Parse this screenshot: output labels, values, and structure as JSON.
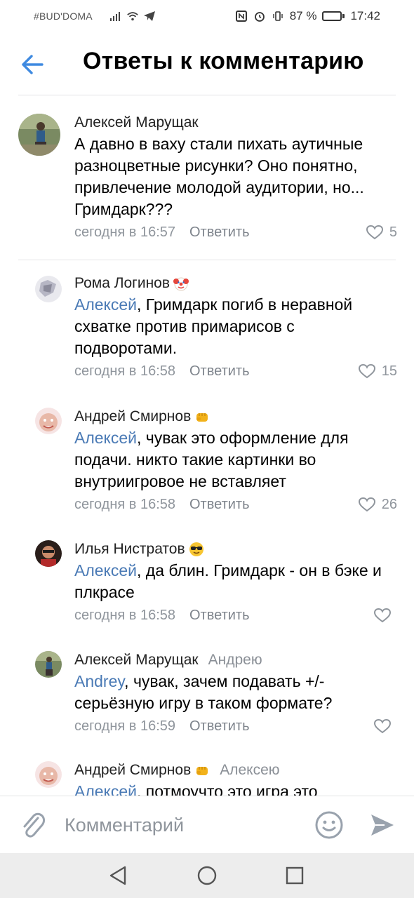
{
  "status_bar": {
    "carrier": "#BUD'DOMA",
    "battery_percent": "87 %",
    "time": "17:42"
  },
  "header": {
    "title": "Ответы к комментарию",
    "back_icon": "arrow-left-icon",
    "accent_color": "#3f8ae0"
  },
  "comments": [
    {
      "author": "Алексей Марущак",
      "emoji": "",
      "reply_to": "",
      "mention": "",
      "text": "А давно в ваху стали пихать аутичные разноцветные рисунки? Оно понятно, привлечение молодой аудитории, но... Гримдарк???",
      "time": "сегодня в 16:57",
      "reply_label": "Ответить",
      "likes": "5"
    },
    {
      "author": "Рома Логинов",
      "emoji": "clown-face-icon",
      "reply_to": "",
      "mention": "Алексей",
      "text": ", Гримдарк погиб в неравной схватке против примарисов с подворотами.",
      "time": "сегодня в 16:58",
      "reply_label": "Ответить",
      "likes": "15"
    },
    {
      "author": "Андрей Смирнов",
      "emoji": "fist-icon",
      "reply_to": "",
      "mention": "Алексей",
      "text": ", чувак это оформление для подачи. никто такие картинки во внутриигровое не вставляет",
      "time": "сегодня в 16:58",
      "reply_label": "Ответить",
      "likes": "26"
    },
    {
      "author": "Илья Нистратов",
      "emoji": "sunglasses-face-icon",
      "reply_to": "",
      "mention": "Алексей",
      "text": ", да блин. Гримдарк - он в бэке и плкрасе",
      "time": "сегодня в 16:58",
      "reply_label": "Ответить",
      "likes": ""
    },
    {
      "author": "Алексей Марущак",
      "emoji": "",
      "reply_to": "Андрею",
      "mention": "Andrey",
      "text": ", чувак, зачем подавать +/- серьёзную игру в таком формате?",
      "time": "сегодня в 16:59",
      "reply_label": "Ответить",
      "likes": ""
    },
    {
      "author": "Андрей Смирнов",
      "emoji": "fist-icon",
      "reply_to": "Алексею",
      "mention": "Алексей",
      "text": ", потмоучто это игра это",
      "time": "",
      "reply_label": "",
      "likes": ""
    }
  ],
  "input": {
    "placeholder": "Комментарий",
    "value": ""
  }
}
